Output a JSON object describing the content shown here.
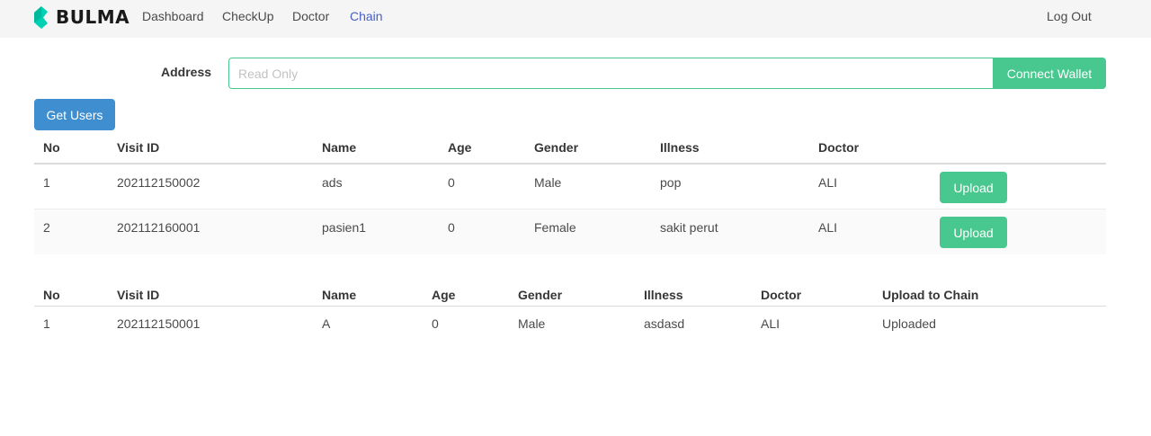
{
  "navbar": {
    "brand": "BULMA",
    "brand_icon": "bulma-logo-icon",
    "items": [
      "Dashboard",
      "CheckUp",
      "Doctor",
      "Chain"
    ],
    "active_item": "Chain",
    "logout": "Log Out"
  },
  "address": {
    "label": "Address",
    "placeholder": "Read Only",
    "connect_label": "Connect Wallet"
  },
  "get_users_label": "Get Users",
  "pending_table": {
    "headers": [
      "No",
      "Visit ID",
      "Name",
      "Age",
      "Gender",
      "Illness",
      "Doctor"
    ],
    "rows": [
      {
        "no": "1",
        "visit_id": "202112150002",
        "name": "ads",
        "age": "0",
        "gender": "Male",
        "illness": "pop",
        "doctor": "ALI",
        "action": "Upload"
      },
      {
        "no": "2",
        "visit_id": "202112160001",
        "name": "pasien1",
        "age": "0",
        "gender": "Female",
        "illness": "sakit perut",
        "doctor": "ALI",
        "action": "Upload"
      }
    ]
  },
  "uploaded_table": {
    "headers": [
      "No",
      "Visit ID",
      "Name",
      "Age",
      "Gender",
      "Illness",
      "Doctor",
      "Upload to Chain"
    ],
    "rows": [
      {
        "no": "1",
        "visit_id": "202112150001",
        "name": "A",
        "age": "0",
        "gender": "Male",
        "illness": "asdasd",
        "doctor": "ALI",
        "status": "Uploaded"
      }
    ]
  },
  "colors": {
    "primary_green": "#48c78e",
    "info_blue": "#3e8ed0",
    "link_active": "#485fc7",
    "navbar_bg": "#f5f5f5"
  }
}
